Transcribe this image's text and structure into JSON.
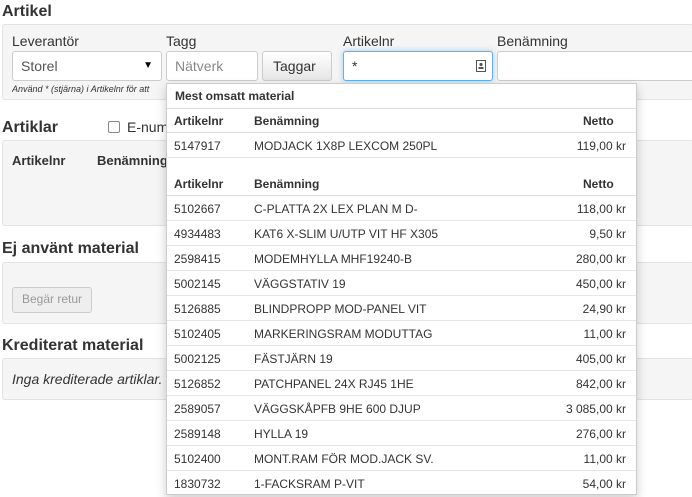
{
  "artikel": {
    "title": "Artikel",
    "leverantor_label": "Leverantör",
    "leverantor_value": "Storel",
    "tagg_label": "Tagg",
    "tagg_placeholder": "Nätverk",
    "taggar_button": "Taggar",
    "artikelnr_label": "Artikelnr",
    "artikelnr_value": "*",
    "benamning_label": "Benämning",
    "hint": "Använd * (stjärna) i Artikelnr för att"
  },
  "artiklar": {
    "title": "Artiklar",
    "checkbox_label": "E-num",
    "col_artikelnr": "Artikelnr",
    "col_benamning": "Benämning"
  },
  "ej_anvant": {
    "title": "Ej använt material",
    "button": "Begär retur"
  },
  "krediterat": {
    "title": "Krediterat material",
    "empty_text": "Inga krediterade artiklar."
  },
  "dropdown": {
    "title": "Mest omsatt material",
    "headers": {
      "artikelnr": "Artikelnr",
      "benamning": "Benämning",
      "netto": "Netto"
    },
    "top_items": [
      {
        "artikelnr": "5147917",
        "benamning": "MODJACK 1X8P LEXCOM 250PL",
        "netto": "119,00 kr"
      }
    ],
    "items": [
      {
        "artikelnr": "5102667",
        "benamning": "C-PLATTA 2X LEX PLAN M D-",
        "netto": "118,00 kr"
      },
      {
        "artikelnr": "4934483",
        "benamning": "KAT6 X-SLIM U/UTP VIT HF X305",
        "netto": "9,50 kr"
      },
      {
        "artikelnr": "2598415",
        "benamning": "MODEMHYLLA MHF19240-B",
        "netto": "280,00 kr"
      },
      {
        "artikelnr": "5002145",
        "benamning": "VÄGGSTATIV 19",
        "netto": "450,00 kr"
      },
      {
        "artikelnr": "5126885",
        "benamning": "BLINDPROPP MOD-PANEL VIT",
        "netto": "24,90 kr"
      },
      {
        "artikelnr": "5102405",
        "benamning": "MARKERINGSRAM MODUTTAG",
        "netto": "11,00 kr"
      },
      {
        "artikelnr": "5002125",
        "benamning": "FÄSTJÄRN 19",
        "netto": "405,00 kr"
      },
      {
        "artikelnr": "5126852",
        "benamning": "PATCHPANEL 24X RJ45 1HE",
        "netto": "842,00 kr"
      },
      {
        "artikelnr": "2589057",
        "benamning": "VÄGGSKÅPFB 9HE 600 DJUP",
        "netto": "3 085,00 kr"
      },
      {
        "artikelnr": "2589148",
        "benamning": "HYLLA 19",
        "netto": "276,00 kr"
      },
      {
        "artikelnr": "5102400",
        "benamning": "MONT.RAM FÖR MOD.JACK SV.",
        "netto": "11,00 kr"
      },
      {
        "artikelnr": "1830732",
        "benamning": "1-FACKSRAM P-VIT",
        "netto": "54,00 kr"
      }
    ]
  }
}
